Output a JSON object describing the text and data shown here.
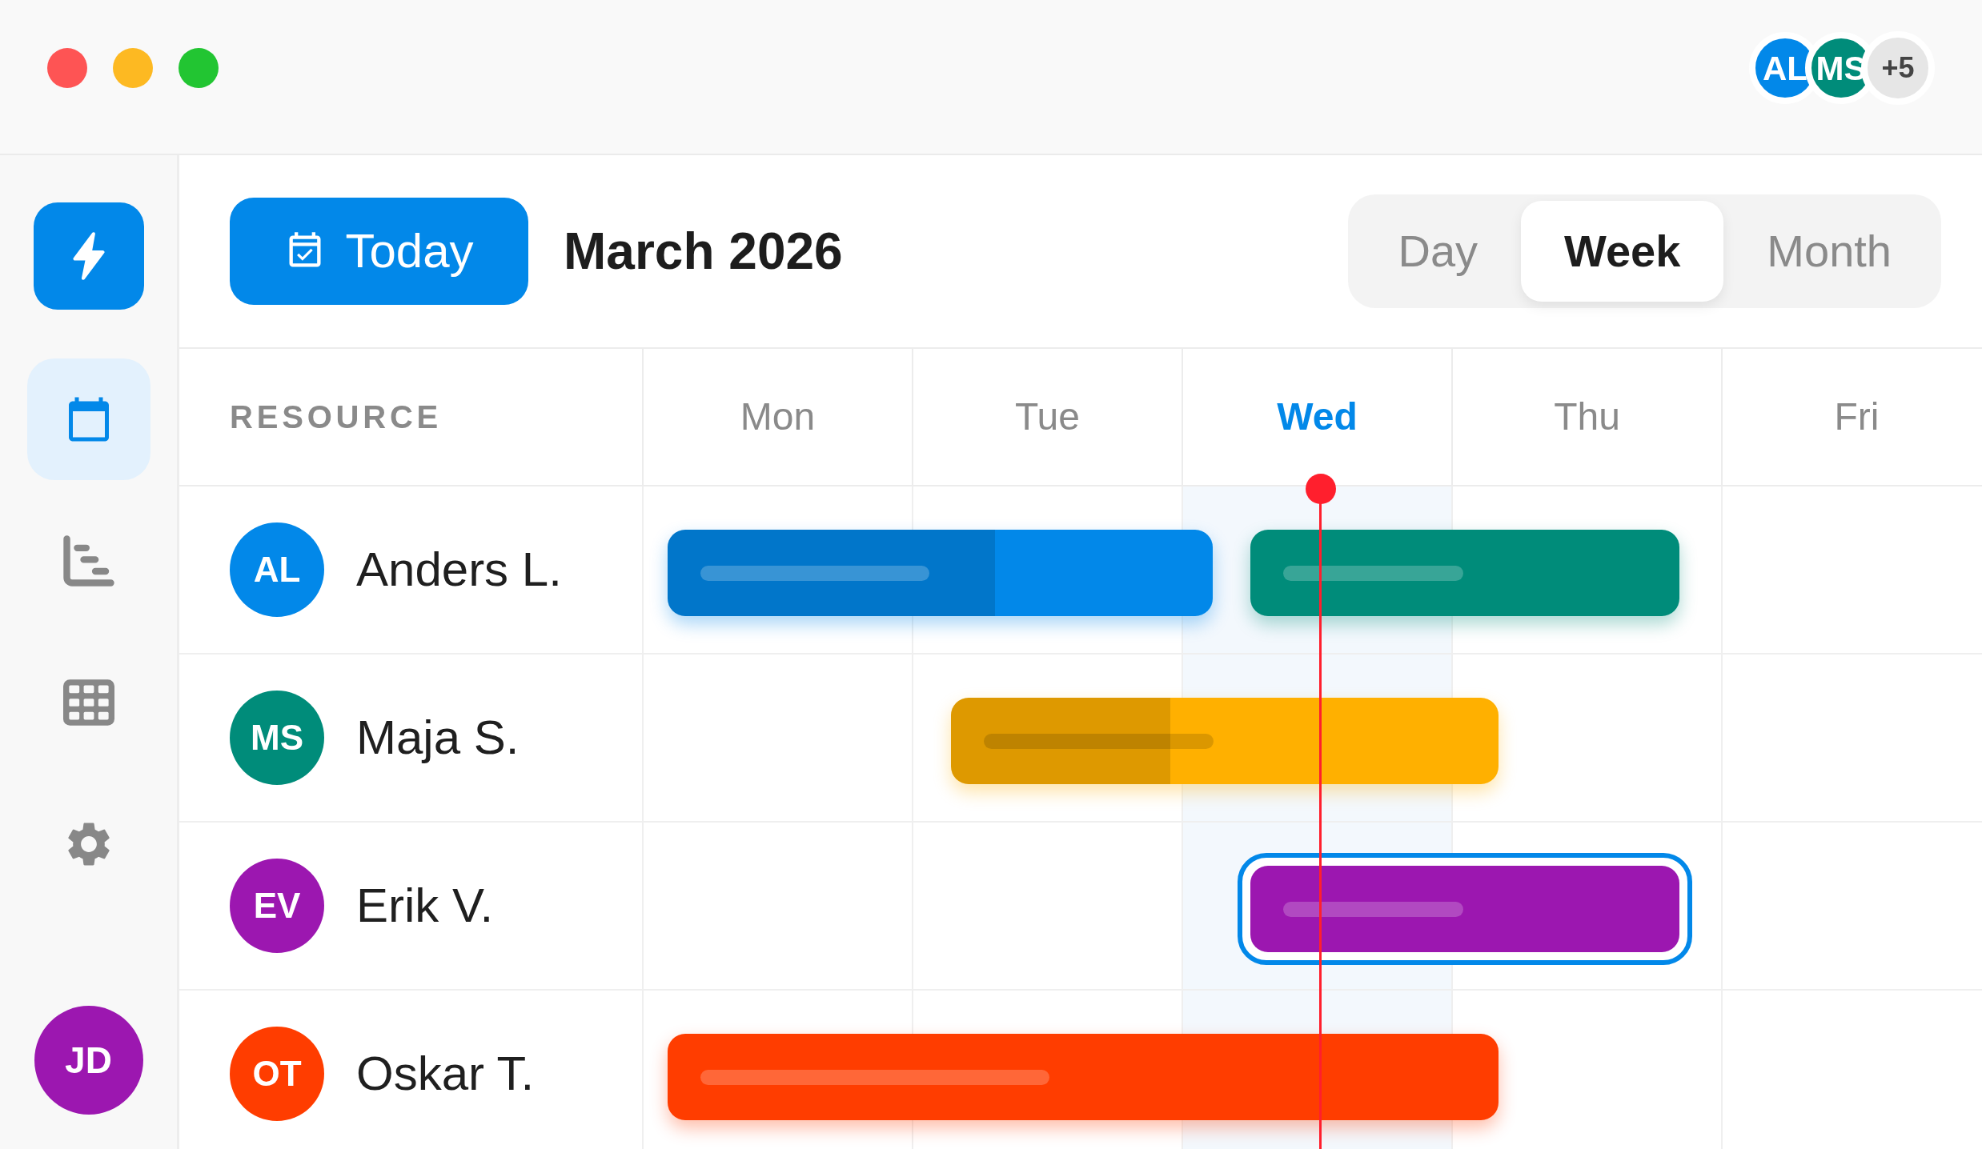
{
  "window": {
    "collaborators": [
      {
        "initials": "AL",
        "color": "#0288e9"
      },
      {
        "initials": "MS",
        "color": "#008c7a"
      }
    ],
    "more_count": "+5"
  },
  "sidebar": {
    "nav": [
      {
        "selected": true
      },
      {
        "selected": false
      },
      {
        "selected": false
      },
      {
        "selected": false
      }
    ],
    "user": {
      "initials": "JD"
    }
  },
  "toolbar": {
    "today_button": "Today",
    "period": "March 2026",
    "views": [
      {
        "label": "Day",
        "selected": false
      },
      {
        "label": "Week",
        "selected": true
      },
      {
        "label": "Month",
        "selected": false
      }
    ]
  },
  "schedule": {
    "resource_heading": "RESOURCE",
    "days": [
      {
        "label": "Mon",
        "current": false
      },
      {
        "label": "Tue",
        "current": false
      },
      {
        "label": "Wed",
        "current": true
      },
      {
        "label": "Thu",
        "current": false
      },
      {
        "label": "Fri",
        "current": false
      }
    ],
    "rows": [
      {
        "initials": "AL",
        "name": "Anders L.",
        "color": "#0288e9",
        "tasks": [
          {
            "color": "#0288e9",
            "level": 0.6,
            "selected": false
          },
          {
            "color": "#008c7a",
            "selected": false
          }
        ]
      },
      {
        "initials": "MS",
        "name": "Maja S.",
        "color": "#008c7a",
        "tasks": [
          {
            "color": "#ffb000",
            "level": 0.4,
            "selected": false
          }
        ]
      },
      {
        "initials": "EV",
        "name": "Erik V.",
        "color": "#9c17b0",
        "tasks": [
          {
            "color": "#9c17b0",
            "selected": true
          }
        ]
      },
      {
        "initials": "OT",
        "name": "Oskar T.",
        "color": "#ff3d00",
        "tasks": [
          {
            "color": "#ff3d00",
            "selected": false
          }
        ]
      }
    ]
  }
}
